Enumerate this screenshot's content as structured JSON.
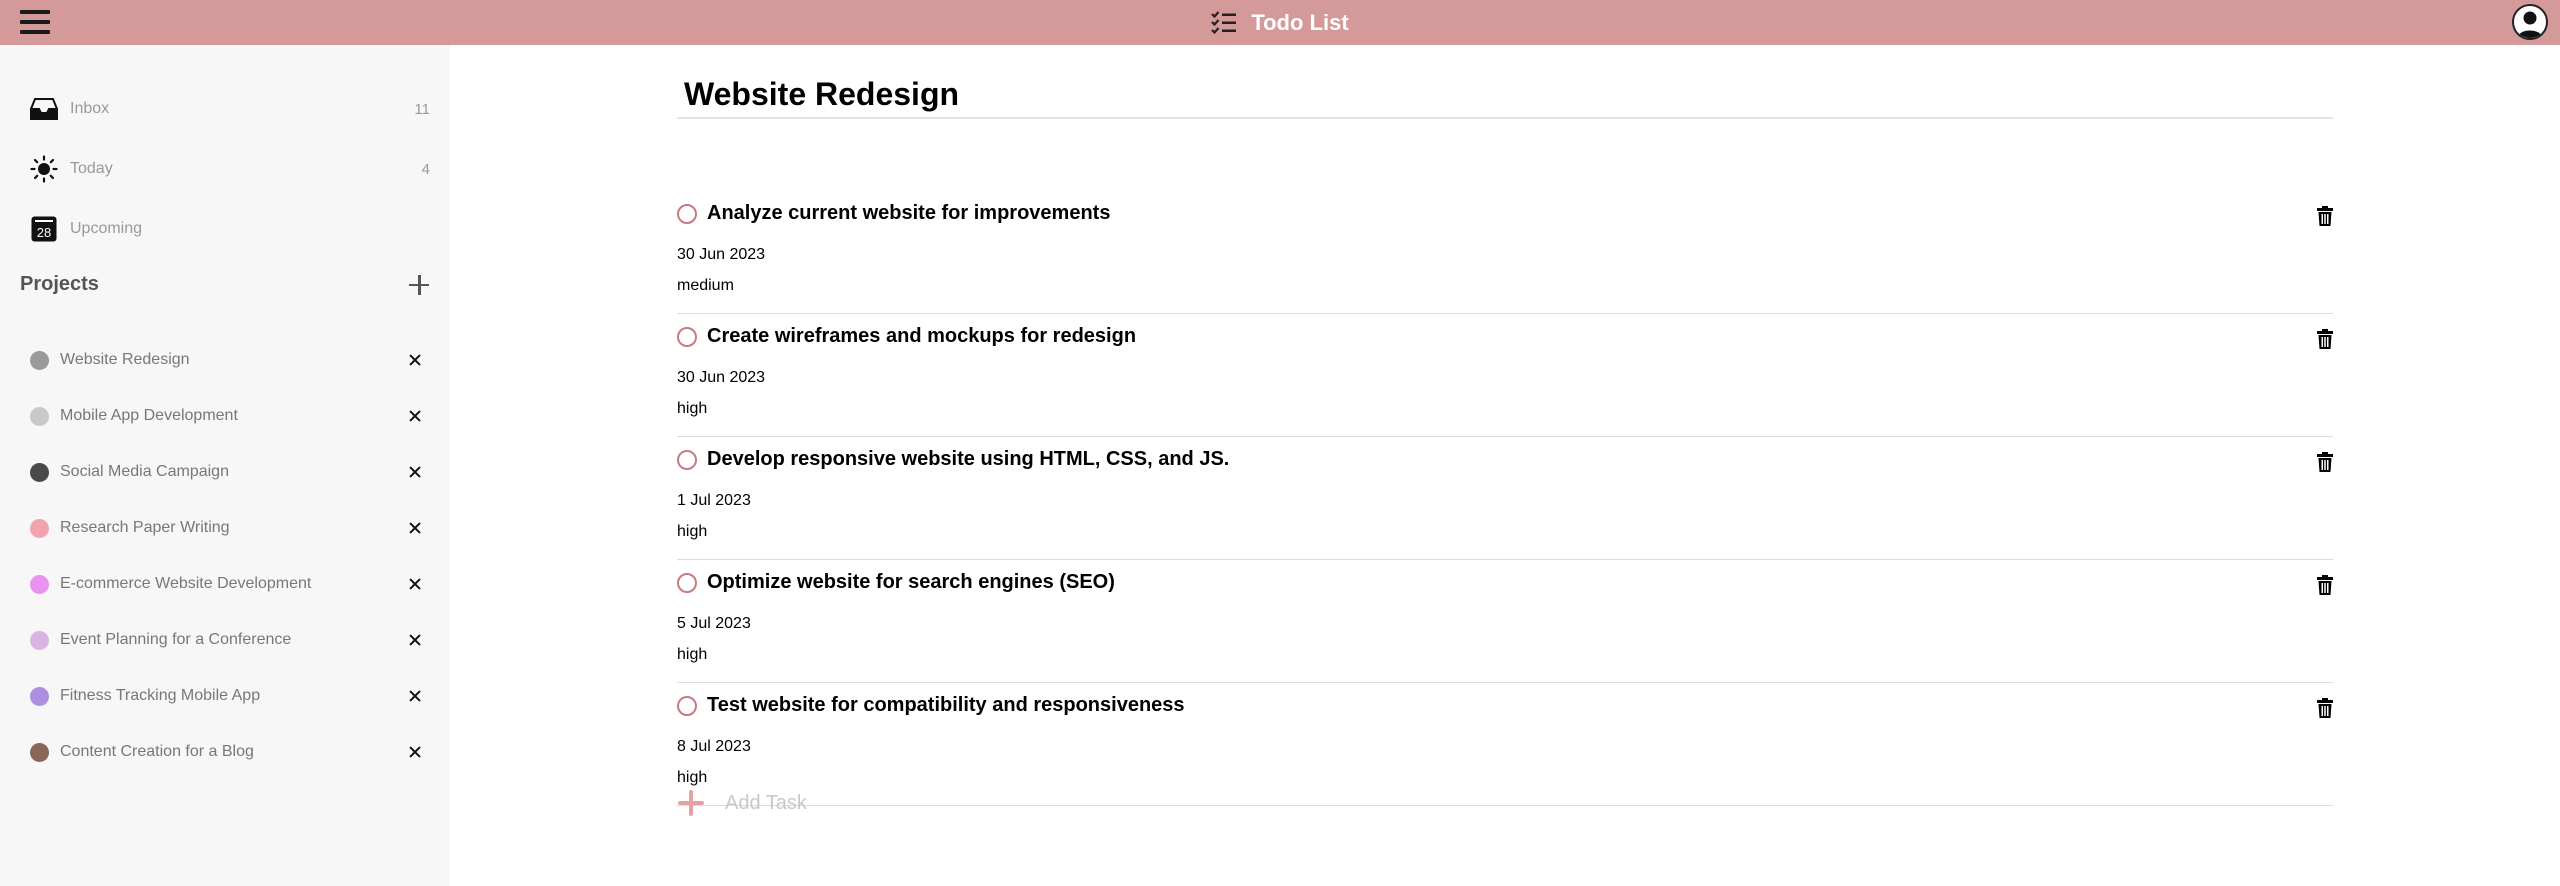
{
  "app": {
    "title": "Todo List",
    "accent_color": "#d49a99"
  },
  "sidebar": {
    "nav": [
      {
        "label": "Inbox",
        "count": "11",
        "icon": "inbox-icon"
      },
      {
        "label": "Today",
        "count": "4",
        "icon": "sun-icon"
      },
      {
        "label": "Upcoming",
        "count": "",
        "icon": "calendar-icon",
        "icon_text": "28"
      }
    ],
    "projects_title": "Projects",
    "projects": [
      {
        "label": "Website Redesign",
        "color": "#9a9a9a"
      },
      {
        "label": "Mobile App Development",
        "color": "#c9c9c9"
      },
      {
        "label": "Social Media Campaign",
        "color": "#4a4a4a"
      },
      {
        "label": "Research Paper Writing",
        "color": "#f2a3ad"
      },
      {
        "label": "E-commerce Website Development",
        "color": "#e893ef"
      },
      {
        "label": "Event Planning for a Conference",
        "color": "#dab3e3"
      },
      {
        "label": "Fitness Tracking Mobile App",
        "color": "#ac90df"
      },
      {
        "label": "Content Creation for a Blog",
        "color": "#8b6559"
      }
    ]
  },
  "main": {
    "title": "Website Redesign",
    "tasks": [
      {
        "title": "Analyze current website for improvements",
        "date": "30 Jun 2023",
        "priority": "medium"
      },
      {
        "title": "Create wireframes and mockups for redesign",
        "date": "30 Jun 2023",
        "priority": "high"
      },
      {
        "title": "Develop responsive website using HTML, CSS, and JS.",
        "date": "1 Jul 2023",
        "priority": "high"
      },
      {
        "title": "Optimize website for search engines (SEO)",
        "date": "5 Jul 2023",
        "priority": "high"
      },
      {
        "title": "Test website for compatibility and responsiveness",
        "date": "8 Jul 2023",
        "priority": "high"
      }
    ],
    "add_task_label": "Add Task"
  }
}
